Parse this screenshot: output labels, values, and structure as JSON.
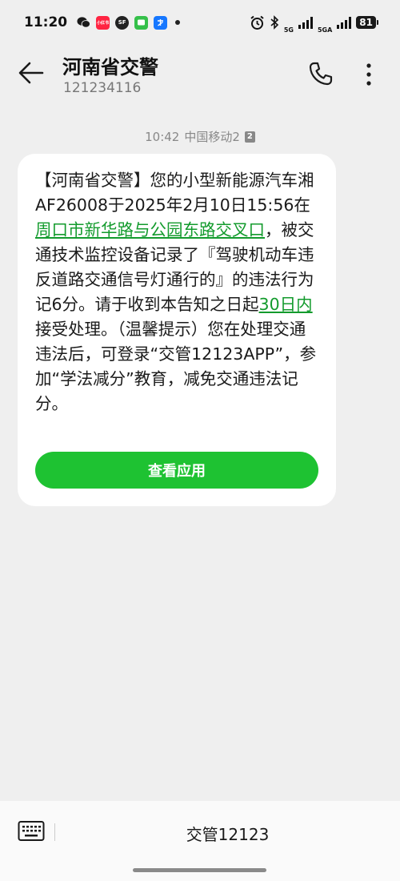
{
  "status_bar": {
    "time": "11:20",
    "app_icons": [
      {
        "name": "wechat-icon",
        "label": "",
        "color": "#2fb44a"
      },
      {
        "name": "xiaohongshu-icon",
        "label": "小红书",
        "color": "#ff2442"
      },
      {
        "name": "sf-express-icon",
        "label": "SF",
        "color": "#222222"
      },
      {
        "name": "messages-icon",
        "label": "",
        "color": "#35c04a"
      },
      {
        "name": "alipay-icon",
        "label": "",
        "color": "#1677ff"
      }
    ],
    "signal_1": "5G",
    "signal_2": "5GA",
    "battery": "81"
  },
  "header": {
    "title": "河南省交警",
    "subtitle": "121234116"
  },
  "message": {
    "time": "10:42",
    "carrier": "中国移动2",
    "sim_badge": "2",
    "segments": {
      "s1": "【河南省交警】您的小型新能源汽车湘AF26008于2025年2月10日15:56在",
      "link_location": "周口市新华路与公园东路交叉口",
      "s2": "，被交通技术监控设备记录了『驾驶机动车违反道路交通信号灯通行的』的违法行为记6分。请于收到本告知之日起",
      "link_deadline": "30日内",
      "s3": "接受处理。（温馨提示）您在处理交通违法后，可登录“交管12123APP”，参加“学法减分”教育，减免交通违法记分。"
    },
    "button_label": "查看应用"
  },
  "bottom_bar": {
    "menu_label": "交管12123"
  },
  "colors": {
    "accent_green": "#1ec232",
    "link_green": "#139b2d",
    "background": "#efefef"
  }
}
